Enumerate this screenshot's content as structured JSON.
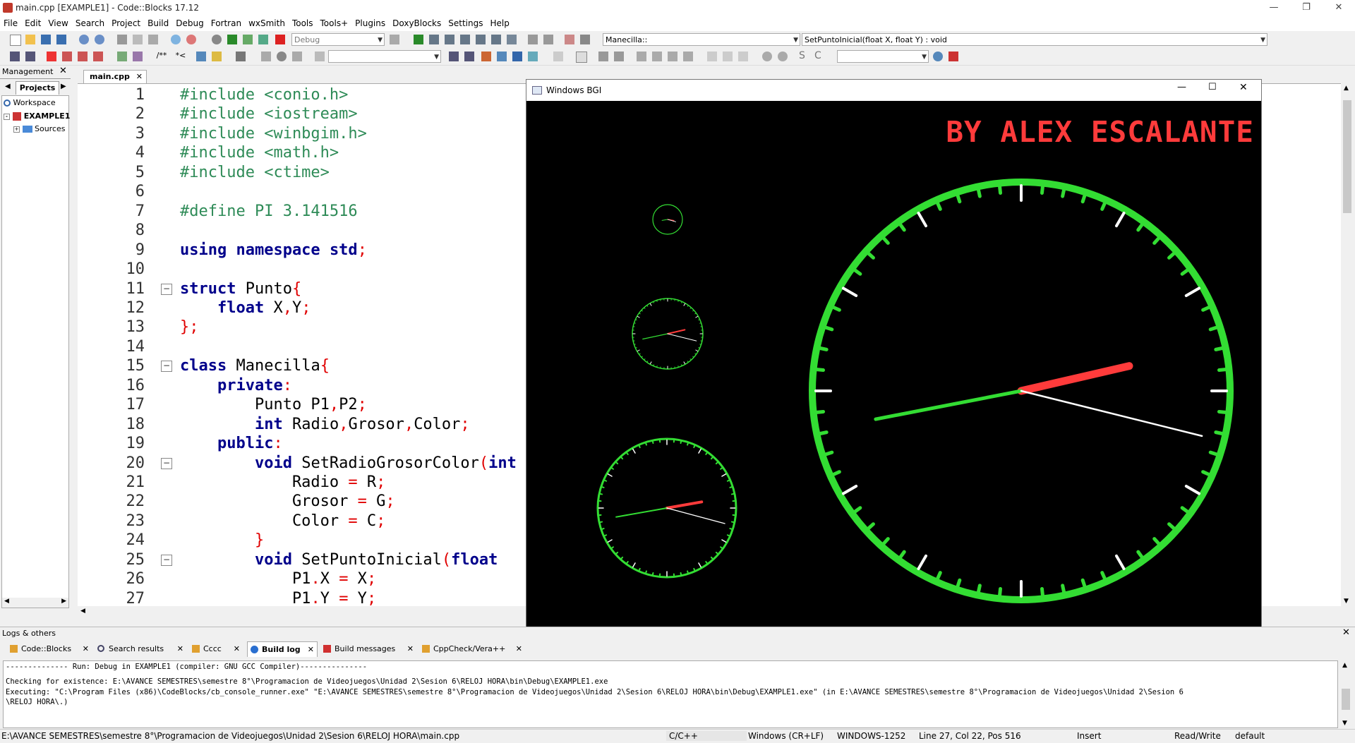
{
  "window": {
    "title": "main.cpp [EXAMPLE1] - Code::Blocks 17.12"
  },
  "menu": [
    "File",
    "Edit",
    "View",
    "Search",
    "Project",
    "Build",
    "Debug",
    "Fortran",
    "wxSmith",
    "Tools",
    "Tools+",
    "Plugins",
    "DoxyBlocks",
    "Settings",
    "Help"
  ],
  "toolbar": {
    "build_target": "Debug",
    "scope": "Manecilla::",
    "function": "SetPuntoInicial(float X, float Y) : void",
    "search_value": "",
    "regex_value": ""
  },
  "management": {
    "title": "Management",
    "tab": "Projects",
    "tree": [
      "Workspace",
      "EXAMPLE1",
      "Sources"
    ]
  },
  "editor": {
    "tab": "main.cpp",
    "lines": [
      "1",
      "2",
      "3",
      "4",
      "5",
      "6",
      "7",
      "8",
      "9",
      "10",
      "11",
      "12",
      "13",
      "14",
      "15",
      "16",
      "17",
      "18",
      "19",
      "20",
      "21",
      "22",
      "23",
      "24",
      "25",
      "26",
      "27"
    ]
  },
  "bgi": {
    "title": "Windows BGI",
    "banner": "BY ALEX ESCALANTE",
    "colors": {
      "face": "#33dd33",
      "hour": "#ff3b3b",
      "minute": "#33dd33",
      "second": "#ffffff",
      "banner": "#ff3b3b"
    }
  },
  "logs": {
    "title": "Logs & others",
    "tabs": [
      "Code::Blocks",
      "Search results",
      "Cccc",
      "Build log",
      "Build messages",
      "CppCheck/Vera++"
    ],
    "active_tab": "Build log",
    "lines": [
      "-------------- Run: Debug in EXAMPLE1 (compiler: GNU GCC Compiler)---------------",
      "Checking for existence: E:\\AVANCE SEMESTRES\\semestre 8°\\Programacion de Videojuegos\\Unidad 2\\Sesion 6\\RELOJ HORA\\bin\\Debug\\EXAMPLE1.exe",
      "Executing: \"C:\\Program Files (x86)\\CodeBlocks/cb_console_runner.exe\" \"E:\\AVANCE SEMESTRES\\semestre 8°\\Programacion de Videojuegos\\Unidad 2\\Sesion 6\\RELOJ HORA\\bin\\Debug\\EXAMPLE1.exe\"  (in E:\\AVANCE SEMESTRES\\semestre 8°\\Programacion de Videojuegos\\Unidad 2\\Sesion 6",
      "\\RELOJ HORA\\.)"
    ]
  },
  "status": {
    "path": "E:\\AVANCE SEMESTRES\\semestre 8°\\Programacion de Videojuegos\\Unidad 2\\Sesion 6\\RELOJ HORA\\main.cpp",
    "lang": "C/C++",
    "eol": "Windows (CR+LF)",
    "encoding": "WINDOWS-1252",
    "position": "Line 27, Col 22, Pos 516",
    "mode": "Insert",
    "access": "Read/Write",
    "profile": "default"
  }
}
